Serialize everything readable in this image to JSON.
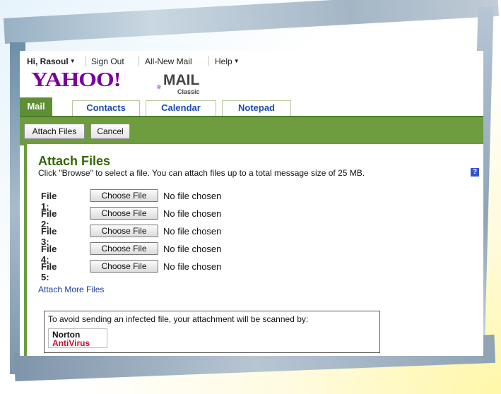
{
  "topbar": {
    "user_label": "Hi, Rasoul",
    "sign_out": "Sign Out",
    "all_new_mail": "All-New Mail",
    "help": "Help"
  },
  "logo": {
    "yahoo": "YAHOO!",
    "reg": "®",
    "mail": "MAIL",
    "classic": "Classic"
  },
  "tabs": [
    {
      "label": "Mail",
      "active": true
    },
    {
      "label": "Contacts",
      "active": false
    },
    {
      "label": "Calendar",
      "active": false
    },
    {
      "label": "Notepad",
      "active": false
    }
  ],
  "toolbar": {
    "attach_files": "Attach Files",
    "cancel": "Cancel"
  },
  "main": {
    "title": "Attach Files",
    "instructions": "Click \"Browse\" to select a file. You can attach files up to a total message size of 25 MB.",
    "help_icon": "?",
    "files": [
      {
        "label": "File 1:",
        "button": "Choose File",
        "status": "No file chosen"
      },
      {
        "label": "File 2:",
        "button": "Choose File",
        "status": "No file chosen"
      },
      {
        "label": "File 3:",
        "button": "Choose File",
        "status": "No file chosen"
      },
      {
        "label": "File 4:",
        "button": "Choose File",
        "status": "No file chosen"
      },
      {
        "label": "File 5:",
        "button": "Choose File",
        "status": "No file chosen"
      }
    ],
    "attach_more": "Attach More Files",
    "scan_notice": "To avoid sending an infected file, your attachment will be scanned by:",
    "norton_line1": "Norton",
    "norton_line2": "AntiVirus"
  },
  "colors": {
    "brand_purple": "#7b0099",
    "green_bar": "#6d9d3e",
    "title_green": "#336600",
    "link_blue": "#1b3f99"
  }
}
